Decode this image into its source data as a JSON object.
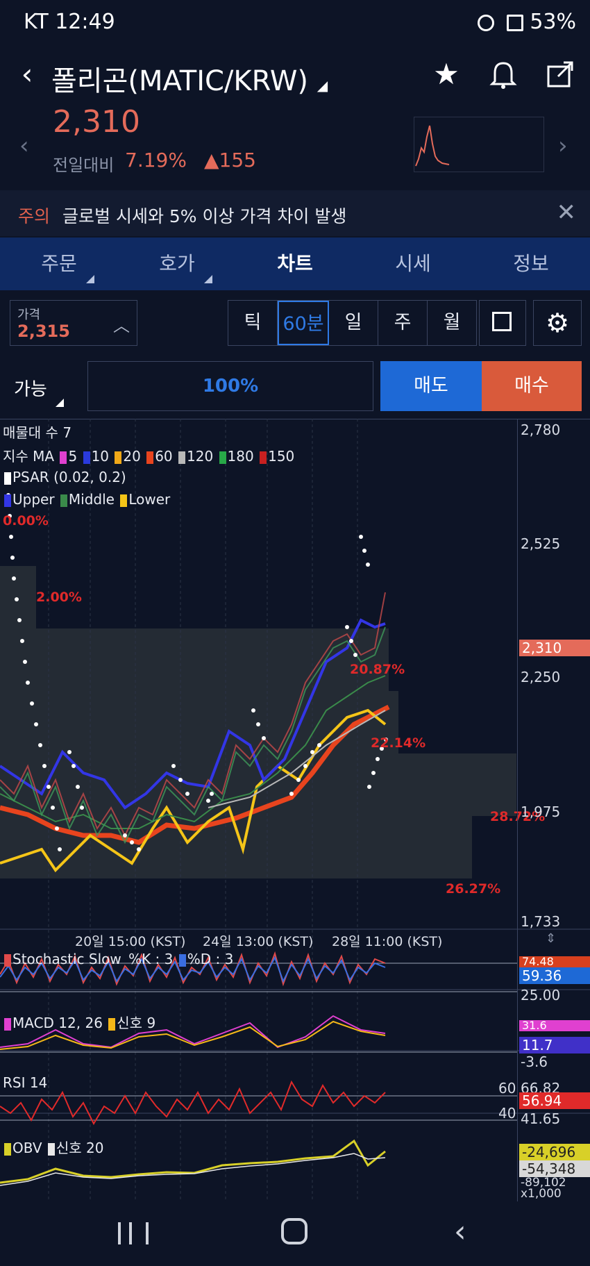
{
  "status_bar": {
    "carrier_time": "KT 12:49",
    "battery": "53%"
  },
  "header": {
    "title": "폴리곤(MATIC/KRW)",
    "back_icon": "chevron-left",
    "favorite_icon": "star",
    "alert_icon": "bell",
    "share_icon": "share"
  },
  "price": {
    "current": "2,310",
    "change_label": "전일대비",
    "change_pct": "7.19%",
    "change_amount": "▲155",
    "color_up": "#e46b5a"
  },
  "notice": {
    "label": "주의",
    "text": "글로벌 시세와 5% 이상 가격 차이 발생"
  },
  "tabs": [
    "주문",
    "호가",
    "차트",
    "시세",
    "정보"
  ],
  "controls": {
    "price_label": "가격",
    "price_value": "2,315",
    "periods": [
      "틱",
      "60분",
      "일",
      "주",
      "월"
    ],
    "active_period": "60분"
  },
  "order": {
    "available_label": "가능",
    "ratio": "100%",
    "sell_label": "매도",
    "buy_label": "매수",
    "sell_color": "#1e69d6",
    "buy_color": "#d95a3b"
  },
  "chart_data": [
    {
      "type": "line",
      "legend": {
        "volume_profile": "매물대 수 7",
        "ma_label": "지수 MA",
        "ma_periods": [
          "5",
          "10",
          "20",
          "60",
          "120",
          "180",
          "150"
        ],
        "psar": "PSAR (0.02, 0.2)",
        "bands": [
          "Upper",
          "Middle",
          "Lower"
        ]
      },
      "y_ticks": [
        "2,780",
        "2,525",
        "2,250",
        "1,975",
        "1,733"
      ],
      "x_ticks": [
        "20일 15:00 (KST)",
        "24일 13:00 (KST)",
        "28일 11:00 (KST)"
      ],
      "current_price_tag": "2,310",
      "volume_profile_pcts": [
        "0.00%",
        "2.00%",
        "20.87%",
        "22.14%",
        "28.72%",
        "26.27%"
      ],
      "ylim": [
        1733,
        2780
      ]
    },
    {
      "type": "line",
      "title": "Stochastic Slow",
      "legend": [
        "%K : 3",
        "%D : 3"
      ],
      "values": [
        "74.48",
        "59.36",
        "25.00"
      ]
    },
    {
      "type": "line",
      "title": "MACD 12, 26",
      "legend": [
        "신호 9"
      ],
      "values": [
        "31.6",
        "11.7",
        "-3.6"
      ]
    },
    {
      "type": "line",
      "title": "RSI 14",
      "levels": [
        "60",
        "40"
      ],
      "values": [
        "66.82",
        "56.94",
        "41.65"
      ]
    },
    {
      "type": "line",
      "title": "OBV",
      "legend": [
        "신호 20"
      ],
      "values": [
        "-24,696",
        "-54,348",
        "-89,102"
      ],
      "unit": "x1,000"
    }
  ]
}
